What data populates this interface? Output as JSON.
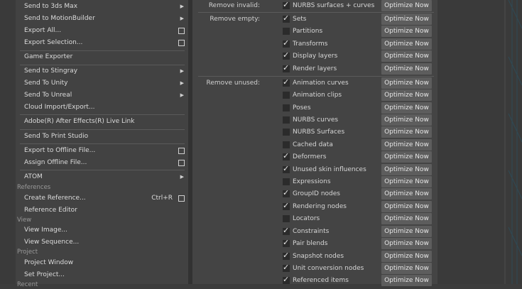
{
  "menu": {
    "rows": [
      {
        "label": "Send to 3ds Max",
        "arrow": true
      },
      {
        "label": "Send to MotionBuilder",
        "arrow": true
      },
      {
        "label": "Export All...",
        "option": true
      },
      {
        "label": "Export Selection...",
        "option": true
      },
      {
        "label": "Game Exporter"
      },
      {
        "label": "Send to Stingray",
        "arrow": true
      },
      {
        "label": "Send To Unity",
        "arrow": true
      },
      {
        "label": "Send To Unreal",
        "arrow": true
      },
      {
        "label": "Cloud Import/Export..."
      },
      {
        "label": "Adobe(R) After Effects(R) Live Link"
      },
      {
        "label": "Send To Print Studio"
      },
      {
        "label": "Export to Offline File...",
        "option": true
      },
      {
        "label": "Assign Offline File...",
        "option": true
      },
      {
        "label": "ATOM",
        "arrow": true
      },
      {
        "label": "Create Reference...",
        "shortcut": "Ctrl+R",
        "option": true
      },
      {
        "label": "Reference Editor"
      },
      {
        "label": "View Image..."
      },
      {
        "label": "View Sequence..."
      },
      {
        "label": "Project Window"
      },
      {
        "label": "Set Project..."
      }
    ],
    "sections": {
      "references": "References",
      "view": "View",
      "project": "Project",
      "recent": "Recent"
    }
  },
  "panel": {
    "groups": {
      "invalid": "Remove invalid:",
      "empty": "Remove empty:",
      "unused": "Remove unused:"
    },
    "button_label": "Optimize Now",
    "items": [
      {
        "label": "NURBS surfaces + curves",
        "checked": true
      },
      {
        "label": "Sets",
        "checked": true
      },
      {
        "label": "Partitions",
        "checked": false
      },
      {
        "label": "Transforms",
        "checked": true
      },
      {
        "label": "Display layers",
        "checked": true
      },
      {
        "label": "Render layers",
        "checked": true
      },
      {
        "label": "Animation curves",
        "checked": true
      },
      {
        "label": "Animation clips",
        "checked": false
      },
      {
        "label": "Poses",
        "checked": false
      },
      {
        "label": "NURBS curves",
        "checked": false
      },
      {
        "label": "NURBS Surfaces",
        "checked": false
      },
      {
        "label": "Cached data",
        "checked": false
      },
      {
        "label": "Deformers",
        "checked": true
      },
      {
        "label": "Unused skin influences",
        "checked": true
      },
      {
        "label": "Expressions",
        "checked": false
      },
      {
        "label": "GroupID nodes",
        "checked": true
      },
      {
        "label": "Rendering nodes",
        "checked": true
      },
      {
        "label": "Locators",
        "checked": false
      },
      {
        "label": "Constraints",
        "checked": true
      },
      {
        "label": "Pair blends",
        "checked": true
      },
      {
        "label": "Snapshot nodes",
        "checked": true
      },
      {
        "label": "Unit conversion nodes",
        "checked": true
      },
      {
        "label": "Referenced items",
        "checked": true
      }
    ]
  }
}
